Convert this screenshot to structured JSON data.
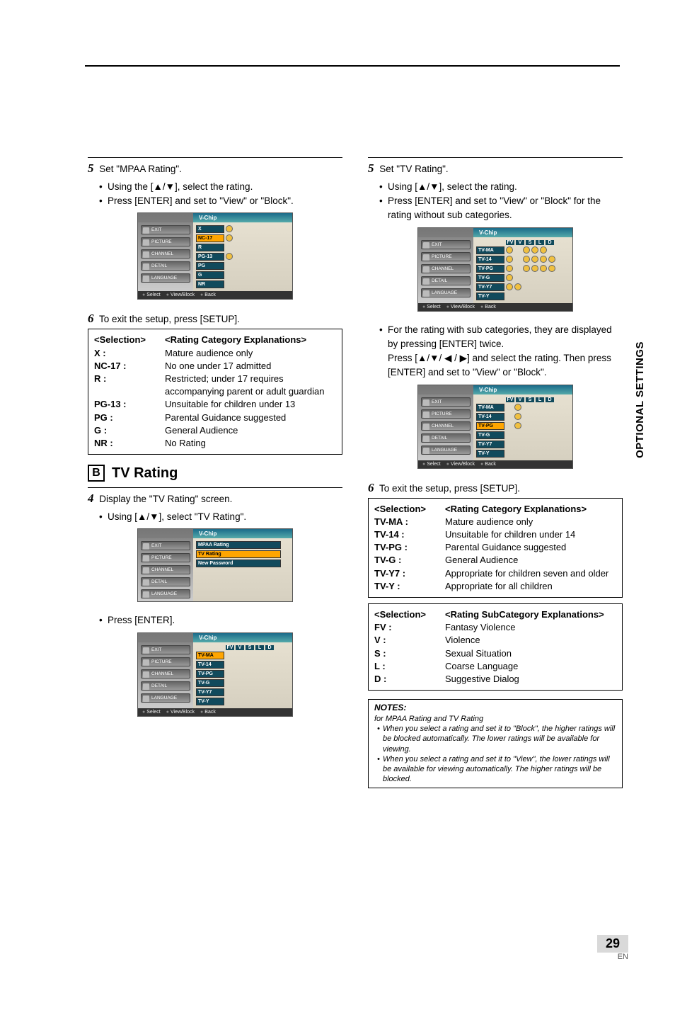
{
  "top_rule": true,
  "left": {
    "step5_num": "5",
    "step5_text": "Set \"MPAA Rating\".",
    "step5_bullets": [
      "Using the [▲/▼], select the rating.",
      "Press [ENTER] and set to \"View\" or \"Block\"."
    ],
    "menu1": {
      "title": "V-Chip",
      "side": [
        "EXIT",
        "PICTURE",
        "CHANNEL",
        "DETAIL",
        "LANGUAGE"
      ],
      "rows": [
        {
          "label": "X",
          "dots": [
            true
          ]
        },
        {
          "label": "NC-17",
          "sel": true,
          "dots": [
            true
          ]
        },
        {
          "label": "R",
          "dots": [
            false
          ]
        },
        {
          "label": "PG-13",
          "dots": [
            true
          ]
        },
        {
          "label": "PG",
          "dots": [
            false
          ]
        },
        {
          "label": "G",
          "dots": [
            false
          ]
        },
        {
          "label": "NR",
          "dots": [
            false
          ]
        }
      ],
      "foot": [
        "Select",
        "View/Block",
        "Back"
      ]
    },
    "step6_num": "6",
    "step6_text": "To exit the setup, press [SETUP].",
    "selbox": {
      "head_left": "<Selection>",
      "head_right": "<Rating Category Explanations>",
      "rows": [
        [
          "X :",
          "Mature audience only"
        ],
        [
          "NC-17 :",
          "No one under 17 admitted"
        ],
        [
          "R :",
          "Restricted; under 17 requires accompanying parent or adult guardian"
        ],
        [
          "PG-13 :",
          "Unsuitable for children under 13"
        ],
        [
          "PG :",
          "Parental Guidance suggested"
        ],
        [
          "G :",
          "General Audience"
        ],
        [
          "NR :",
          "No Rating"
        ]
      ]
    },
    "section_letter": "B",
    "section_title": "TV Rating",
    "step4_num": "4",
    "step4_text": "Display the \"TV Rating\" screen.",
    "step4_bullets": [
      "Using [▲/▼], select \"TV Rating\"."
    ],
    "menu2": {
      "title": "V-Chip",
      "side": [
        "EXIT",
        "PICTURE",
        "CHANNEL",
        "DETAIL",
        "LANGUAGE"
      ],
      "lines": [
        "MPAA Rating",
        "TV Rating",
        "New Password"
      ]
    },
    "press_enter": "Press [ENTER].",
    "menu3": {
      "title": "V-Chip",
      "side": [
        "EXIT",
        "PICTURE",
        "CHANNEL",
        "DETAIL",
        "LANGUAGE"
      ],
      "cols": [
        "FV",
        "V",
        "S",
        "L",
        "D"
      ],
      "rows": [
        "TV-MA",
        "TV-14",
        "TV-PG",
        "TV-G",
        "TV-Y7",
        "TV-Y"
      ],
      "foot": [
        "Select",
        "View/Block",
        "Back"
      ]
    }
  },
  "right": {
    "step5_num": "5",
    "step5_text": "Set \"TV Rating\".",
    "step5_bullets": [
      "Using [▲/▼], select the rating.",
      "Press [ENTER] and set to \"View\" or \"Block\" for the rating without sub categories."
    ],
    "menuA": {
      "title": "V-Chip",
      "side": [
        "EXIT",
        "PICTURE",
        "CHANNEL",
        "DETAIL",
        "LANGUAGE"
      ],
      "cols": [
        "FV",
        "V",
        "S",
        "L",
        "D"
      ],
      "rows": [
        "TV-MA",
        "TV-14",
        "TV-PG",
        "TV-G",
        "TV-Y7",
        "TV-Y"
      ],
      "foot": [
        "Select",
        "View/Block",
        "Back"
      ]
    },
    "sub_bullet": "For the rating with sub categories, they are displayed by pressing [ENTER] twice.",
    "sub_line2": "Press [▲/▼/ ◀ / ▶] and select the rating. Then press [ENTER] and set to \"View\" or \"Block\".",
    "menuB": {
      "title": "V-Chip",
      "side": [
        "EXIT",
        "PICTURE",
        "CHANNEL",
        "DETAIL",
        "LANGUAGE"
      ],
      "cols": [
        "FV",
        "V",
        "S",
        "L",
        "D"
      ],
      "rows": [
        "TV-MA",
        "TV-14",
        "TV-PG",
        "TV-G",
        "TV-Y7",
        "TV-Y"
      ],
      "foot": [
        "Select",
        "View/Block",
        "Back"
      ]
    },
    "step6_num": "6",
    "step6_text": "To exit the setup, press [SETUP].",
    "selbox1": {
      "head_left": "<Selection>",
      "head_right": "<Rating Category Explanations>",
      "rows": [
        [
          "TV-MA :",
          "Mature audience only"
        ],
        [
          "TV-14 :",
          "Unsuitable for children under 14"
        ],
        [
          "TV-PG :",
          "Parental Guidance suggested"
        ],
        [
          "TV-G :",
          "General Audience"
        ],
        [
          "TV-Y7 :",
          "Appropriate for children seven and older"
        ],
        [
          "TV-Y :",
          "Appropriate for all children"
        ]
      ]
    },
    "selbox2": {
      "head_left": "<Selection>",
      "head_right": "<Rating SubCategory Explanations>",
      "rows": [
        [
          "FV :",
          "Fantasy Violence"
        ],
        [
          "V :",
          "Violence"
        ],
        [
          "S :",
          "Sexual Situation"
        ],
        [
          "L :",
          "Coarse Language"
        ],
        [
          "D :",
          "Suggestive Dialog"
        ]
      ]
    },
    "notes": {
      "heading": "NOTES:",
      "sub": "for MPAA Rating and TV Rating",
      "items": [
        "When you select a rating and set it to \"Block\", the higher ratings will be blocked automatically. The lower ratings will be available for viewing.",
        "When you select a rating and set it to \"View\", the lower ratings will be available for viewing automatically. The higher ratings will be blocked."
      ]
    }
  },
  "side_tab": "OPTIONAL SETTINGS",
  "page_number": "29",
  "page_lang": "EN"
}
